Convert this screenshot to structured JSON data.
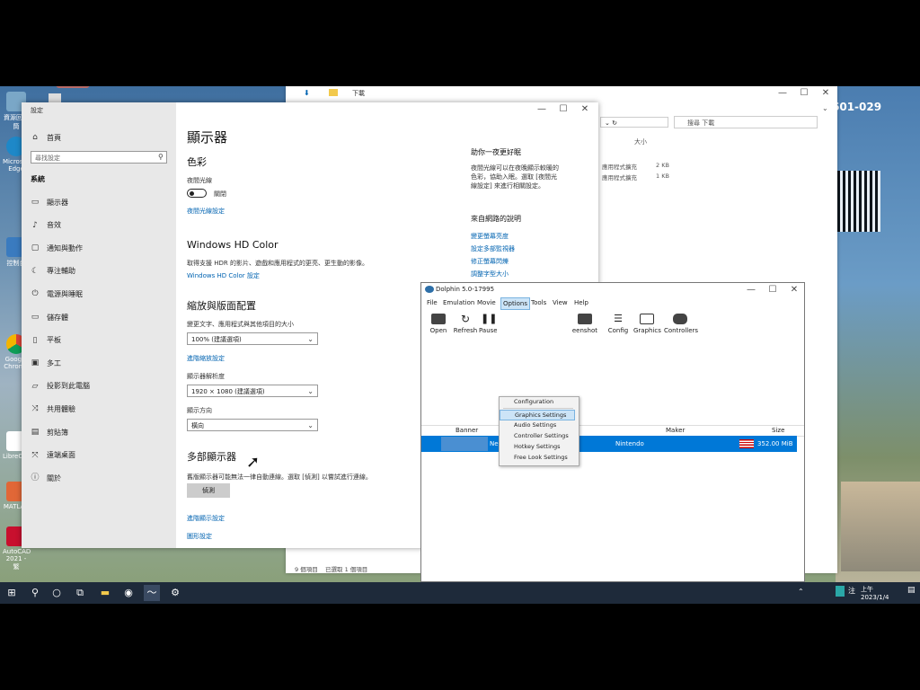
{
  "desktop": {
    "icons": [
      {
        "label": "資源回收筒"
      },
      {
        "label": "Microsoft Edge"
      },
      {
        "label": "控制台"
      },
      {
        "label": "Google Chrome"
      },
      {
        "label": "LibreOffice"
      },
      {
        "label": "MATLAB"
      },
      {
        "label": "AutoCAD 2021 - 繁"
      }
    ],
    "watermark_text": "601-029"
  },
  "settings": {
    "title": "設定",
    "home": "首頁",
    "search_placeholder": "尋找設定",
    "section": "系統",
    "nav": [
      {
        "label": "顯示器",
        "icon": "monitor-icon"
      },
      {
        "label": "音效",
        "icon": "speaker-icon"
      },
      {
        "label": "通知與動作",
        "icon": "notification-icon"
      },
      {
        "label": "專注輔助",
        "icon": "moon-icon"
      },
      {
        "label": "電源與睡眠",
        "icon": "power-icon"
      },
      {
        "label": "儲存體",
        "icon": "storage-icon"
      },
      {
        "label": "平板",
        "icon": "tablet-icon"
      },
      {
        "label": "多工",
        "icon": "multitask-icon"
      },
      {
        "label": "投影到此電腦",
        "icon": "project-icon"
      },
      {
        "label": "共用體驗",
        "icon": "share-icon"
      },
      {
        "label": "剪貼簿",
        "icon": "clipboard-icon"
      },
      {
        "label": "遠端桌面",
        "icon": "remote-icon"
      },
      {
        "label": "關於",
        "icon": "info-icon"
      }
    ],
    "page_title": "顯示器",
    "color_heading": "色彩",
    "night_light_label": "夜間光線",
    "night_light_state": "關閉",
    "night_light_link": "夜間光線設定",
    "hdr_heading": "Windows HD Color",
    "hdr_desc": "取得支援 HDR 的影片、遊戲和應用程式的更亮、更生動的影像。",
    "hdr_link": "Windows HD Color 設定",
    "scale_heading": "縮放與版面配置",
    "scale_label": "變更文字、應用程式與其他項目的大小",
    "scale_value": "100% (建議選項)",
    "scale_link": "進階縮放設定",
    "resolution_label": "顯示器解析度",
    "resolution_value": "1920 × 1080 (建議選項)",
    "orientation_label": "顯示方向",
    "orientation_value": "橫向",
    "multi_heading": "多部顯示器",
    "multi_desc": "舊版顯示器可能無法一律自動連線。選取 [偵測] 以嘗試進行連線。",
    "detect_button": "偵測",
    "advanced_link": "進階顯示設定",
    "graphics_link": "圖形設定",
    "right_heading": "助你一夜更好眠",
    "right_desc": "夜間光線可以在夜晚顯示較暖的色彩，協助入眠。選取 [夜間光線設定] 來進行相關設定。",
    "help_heading": "來自網路的說明",
    "help_links": [
      "變更螢幕亮度",
      "設定多部監視器",
      "修正螢幕閃爍",
      "調整字型大小"
    ]
  },
  "explorer": {
    "title": "下載",
    "search_placeholder": "搜尋 下載",
    "col_size": "大小",
    "rows": [
      {
        "type": "應用程式擴充",
        "size": "2 KB"
      },
      {
        "type": "應用程式擴充",
        "size": "1 KB"
      }
    ],
    "status_count": "9 個項目",
    "status_selected": "已選取 1 個項目"
  },
  "dolphin": {
    "title": "Dolphin 5.0-17995",
    "menu": [
      "File",
      "Emulation",
      "Movie",
      "Options",
      "Tools",
      "View",
      "Help"
    ],
    "toolbar": [
      "Open",
      "Refresh",
      "Pause",
      "Screenshot",
      "Config",
      "Graphics",
      "Controllers"
    ],
    "columns": {
      "banner": "Banner",
      "maker": "Maker",
      "size": "Size"
    },
    "game": {
      "title_prefix": "Ne",
      "maker": "Nintendo",
      "size": "352.00 MiB"
    },
    "options_menu": [
      "Configuration",
      "Graphics Settings",
      "Audio Settings",
      "Controller Settings",
      "Hotkey Settings",
      "Free Look Settings"
    ]
  },
  "taskbar": {
    "ime": "注",
    "time": "上午",
    "date": "2023/1/4"
  },
  "colors": {
    "accent": "#0078d7",
    "selection": "#0078d7",
    "taskbar": "#1e2a3a"
  }
}
